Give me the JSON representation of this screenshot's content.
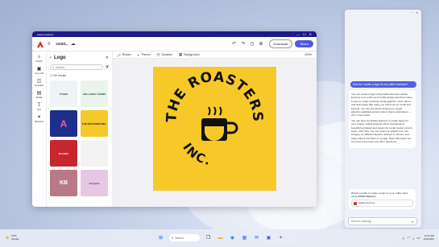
{
  "window": {
    "title": "Adobe Express",
    "controls": [
      "—",
      "☐",
      "✕"
    ]
  },
  "toolbar": {
    "doc_title": "Untitl...",
    "download_label": "Download",
    "share_label": "Share",
    "undo_icon": "↶",
    "redo_icon": "↷",
    "time_icon": "◷"
  },
  "rail": {
    "items": [
      {
        "label": "Search",
        "icon": "⌕"
      },
      {
        "label": "Your stuff",
        "icon": "▣"
      },
      {
        "label": "Templates",
        "icon": "◫"
      },
      {
        "label": "Media",
        "icon": "▤"
      },
      {
        "label": "Text",
        "icon": "T"
      },
      {
        "label": "Elements",
        "icon": "✶"
      }
    ]
  },
  "panel": {
    "title": "Logo",
    "search_placeholder": "Search",
    "results_count": "1,739 results",
    "thumbs": [
      {
        "label": "TITANS",
        "bg": "#eef3f5",
        "fg": "#1b4a5a"
      },
      {
        "label": "HOLLOWAY FARMS",
        "bg": "#eaf3ec",
        "fg": "#21523a"
      },
      {
        "label": "A",
        "bg": "#1c2f8c",
        "fg": "#ff5b8a"
      },
      {
        "label": "THE ROASTERS INC.",
        "bg": "#f6c929",
        "fg": "#111"
      },
      {
        "label": "Bondark",
        "bg": "#c8262e",
        "fg": "#fff"
      },
      {
        "label": "",
        "bg": "#f3f3f3",
        "fg": "#111"
      },
      {
        "label": "KB",
        "bg": "#b97a86",
        "fg": "#fff"
      },
      {
        "label": "Burgeble",
        "bg": "#e6c7e3",
        "fg": "#5b2f9c"
      }
    ]
  },
  "ctx_bar": {
    "items": [
      {
        "label": "Resize",
        "icon": "⤢"
      },
      {
        "label": "Theme",
        "icon": "◐"
      },
      {
        "label": "Duration",
        "icon": "◷"
      },
      {
        "label": "Background",
        "icon": "▦"
      }
    ],
    "zoom": "100%"
  },
  "artboard": {
    "bg": "#f6c929",
    "logo_text": "THE ROASTERS INC."
  },
  "copilot": {
    "header_icons": [
      "⋯",
      "✕"
    ],
    "user_message": "How do I create a logo for my coffee business?",
    "ai_paragraphs": [
      "You can create a logo using Adobe Express. Adobe Express is an online and mobile design app that makes it easy to create stunning social graphics, short videos, and web pages that make you stand out on social and beyond. You can use Adobe Express to create attention-grabbing social content, flyers, animations — all in a few clicks.",
      "You can also use Adobe Express to create logos for your project. Adobe Express offers thousands of beautiful templates and assets for social media content, logos, and more. You can select or upload your own imagery, try different layouts, add text or photos, and apply effects and filters in a snap. Hope this helps! Let me know if you have any other questions."
    ],
    "followup_text": "Would you like to create a logo for your coffee shop using",
    "followup_link": "Adobe Express",
    "chip_label": "Adobe Express",
    "input_placeholder": "Ask me anything..."
  },
  "taskbar": {
    "weather_temp": "59°F",
    "weather_desc": "Cloudy",
    "search_label": "Search",
    "time": "11:11 AM",
    "date": "10/4/2023"
  }
}
